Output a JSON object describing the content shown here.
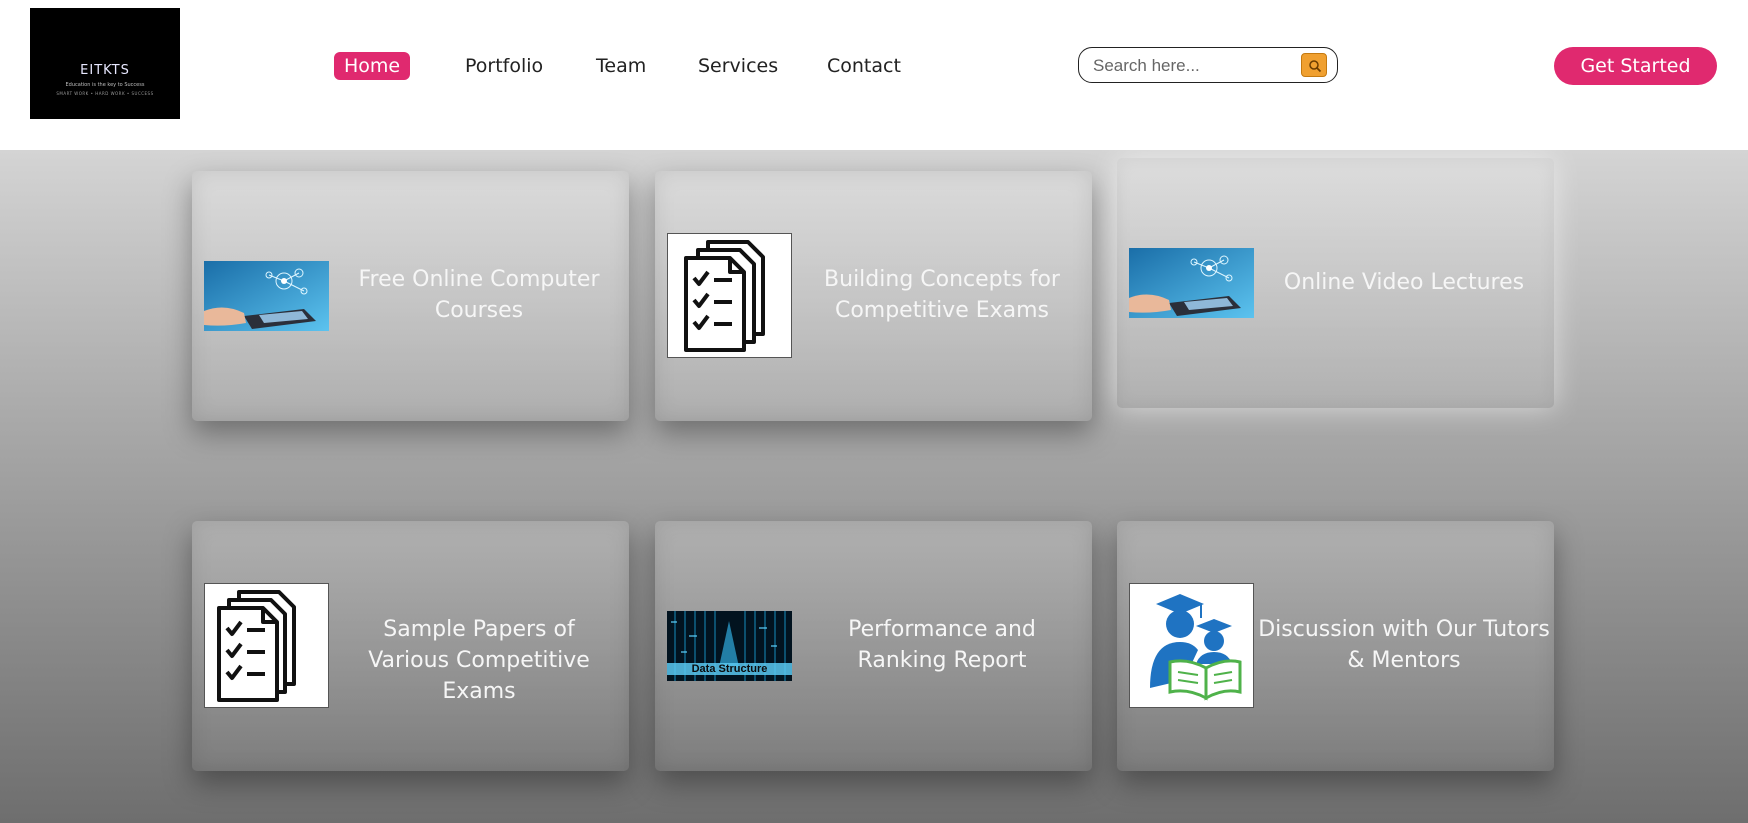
{
  "header": {
    "logo": {
      "title": "EITKTS",
      "tagline": "Education is the key to Success",
      "subline": "SMART WORK • HARD WORK • SUCCESS"
    },
    "nav": [
      {
        "label": "Home",
        "active": true
      },
      {
        "label": "Portfolio",
        "active": false
      },
      {
        "label": "Team",
        "active": false
      },
      {
        "label": "Services",
        "active": false
      },
      {
        "label": "Contact",
        "active": false
      }
    ],
    "search": {
      "placeholder": "Search here...",
      "value": "",
      "button_icon": "search-icon"
    },
    "cta_label": "Get Started"
  },
  "cards": [
    {
      "title": "Free Online Computer Courses",
      "image": "laptop-network-photo"
    },
    {
      "title": "Building Concepts for Competitive Exams",
      "image": "checklist-document-icon"
    },
    {
      "title": "Online Video Lectures",
      "image": "laptop-network-photo"
    },
    {
      "title": "Sample Papers of Various Competitive Exams",
      "image": "checklist-document-icon"
    },
    {
      "title": "Performance and Ranking Report",
      "image": "data-structure-image",
      "image_caption": "Data Structure"
    },
    {
      "title": "Discussion with Our Tutors & Mentors",
      "image": "graduates-reading-book-icon"
    }
  ],
  "colors": {
    "accent": "#e0296f",
    "search_button": "#f0a030",
    "header_bg": "#ffffff",
    "card_text": "#f6f6f6"
  }
}
